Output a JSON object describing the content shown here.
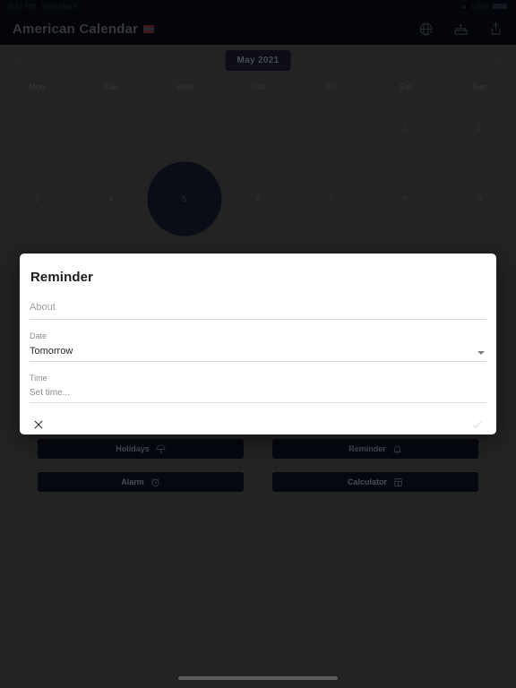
{
  "status_bar": {
    "time": "4:12 PM",
    "date": "Wed May 5",
    "wifi_icon": "wifi-icon",
    "battery_label": "100%"
  },
  "app_bar": {
    "title": "American Calendar",
    "flag_icon": "us-flag-icon",
    "actions": [
      {
        "name": "globe-icon",
        "label": "Globe"
      },
      {
        "name": "cake-icon",
        "label": "Birthdays"
      },
      {
        "name": "share-icon",
        "label": "Share"
      }
    ]
  },
  "calendar": {
    "prev_label": "‹",
    "next_label": "›",
    "month_label": "May 2021",
    "weekday_headers": [
      "Mon",
      "Tue",
      "Wed",
      "Thu",
      "Fri",
      "Sat",
      "Sun"
    ],
    "weeks": [
      [
        "",
        "",
        "",
        "",
        "",
        "1",
        "2"
      ],
      [
        "3",
        "4",
        "5",
        "6",
        "7",
        "8",
        "9"
      ]
    ],
    "selected_day": "5",
    "selected_circle_color": "#0a0d16"
  },
  "quick_actions": [
    {
      "label": "Holidays",
      "icon": "umbrella-icon"
    },
    {
      "label": "Reminder",
      "icon": "bell-icon"
    },
    {
      "label": "Alarm",
      "icon": "alarm-clock-icon"
    },
    {
      "label": "Calculator",
      "icon": "calculator-icon"
    }
  ],
  "dialog": {
    "title": "Reminder",
    "about": {
      "placeholder": "About",
      "value": ""
    },
    "date": {
      "label": "Date",
      "value": "Tomorrow"
    },
    "time": {
      "label": "Time",
      "placeholder": "Set time..."
    },
    "cancel_icon": "close-icon",
    "confirm_icon": "check-icon"
  },
  "colors": {
    "app_bar_bg": "#05080f",
    "page_bg": "#343434",
    "dialog_bg": "#ffffff",
    "accent_pill": "#14161f"
  }
}
